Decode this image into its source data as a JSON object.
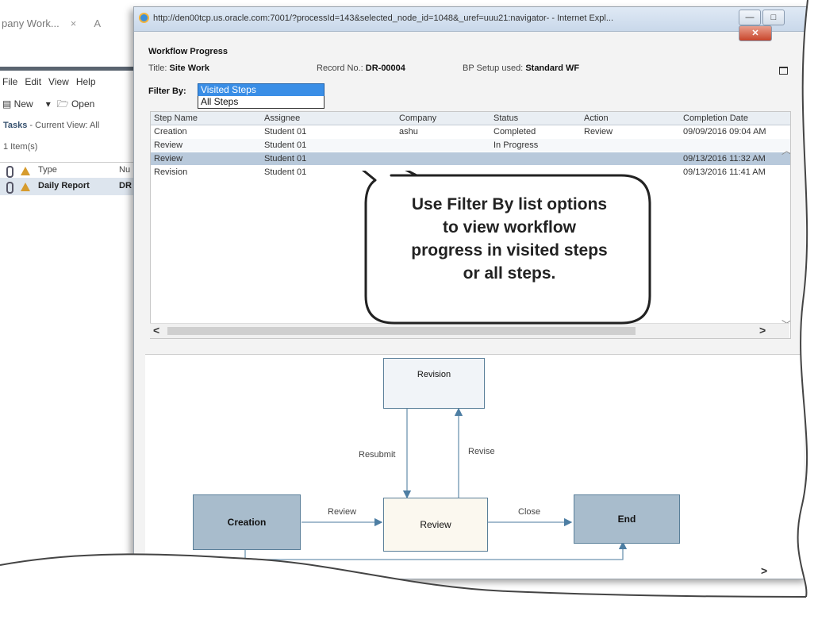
{
  "background_app": {
    "tab_label": "pany Work...",
    "tab_close": "×",
    "tab_next": "A",
    "menu": [
      "File",
      "Edit",
      "View",
      "Help"
    ],
    "toolbar": [
      "New",
      "▾",
      "Open"
    ],
    "tasks_label": "Tasks",
    "tasks_view": " - Current View: All",
    "items_count": "1 Item(s)",
    "columns": [
      "Type",
      "Nu"
    ],
    "row": {
      "type": "Daily Report",
      "number": "DR"
    }
  },
  "window": {
    "url": "http://den00tcp.us.oracle.com:7001/?processId=143&selected_node_id=1048&_uref=uuu21:navigator- - Internet Expl...",
    "buttons": {
      "minimize": "—",
      "maximize": "□",
      "close": "✕"
    }
  },
  "workflow": {
    "heading": "Workflow Progress",
    "title_label": "Title:",
    "title_value": "Site Work",
    "record_label": "Record No.:",
    "record_value": "DR-00004",
    "bp_label": "BP Setup used:",
    "bp_value": "Standard WF",
    "filter_label": "Filter By:",
    "filter_selected": "Visited Steps",
    "filter_options": [
      "Visited Steps",
      "All Steps"
    ]
  },
  "table": {
    "columns": [
      "Step Name",
      "Assignee",
      "Company",
      "Status",
      "Action",
      "Completion Date"
    ],
    "rows": [
      [
        "Creation",
        "Student 01",
        "ashu",
        "Completed",
        "Review",
        "09/09/2016 09:04 AM"
      ],
      [
        "Review",
        "Student 01",
        "",
        "In Progress",
        "",
        ""
      ],
      [
        "Review",
        "Student 01",
        "",
        "",
        "",
        "09/13/2016 11:32 AM"
      ],
      [
        "Revision",
        "Student 01",
        "",
        "",
        "",
        "09/13/2016 11:41 AM"
      ]
    ],
    "selected_row": 2,
    "scroll_left": "<",
    "scroll_right": ">"
  },
  "callout": {
    "text_lines": [
      "Use Filter By list options",
      "to view workflow",
      "progress in visited steps",
      "or all steps."
    ]
  },
  "diagram": {
    "nodes": {
      "revision": "Revision",
      "creation": "Creation",
      "review": "Review",
      "end": "End"
    },
    "edges": {
      "resubmit": "Resubmit",
      "revise": "Revise",
      "review": "Review",
      "close": "Close"
    },
    "scroll_right": ">"
  }
}
